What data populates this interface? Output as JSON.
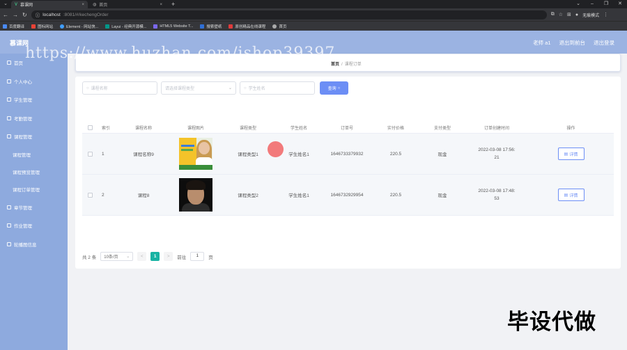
{
  "browser": {
    "tabs": [
      {
        "title": "慕课网"
      },
      {
        "title": "首页"
      }
    ],
    "address": {
      "host": "localhost",
      "path": ":8081/#/kechengOrder"
    },
    "profile": "无痕模式",
    "bookmarks": [
      "百度翻译",
      "图标网站",
      "Element - 网站快...",
      "Layui - 经典开源模...",
      "HTML5 Website T...",
      "搜索壁纸",
      "原创精品在线课程",
      "首页"
    ]
  },
  "header": {
    "brand": "慕课网",
    "user": "老师 a1",
    "exit_backend": "退出到前台",
    "logout": "退出登录"
  },
  "watermark": "https://www.huzhan.com/ishop39397",
  "sidebar": {
    "items": [
      {
        "label": "首页"
      },
      {
        "label": "个人中心"
      },
      {
        "label": "学生管理"
      },
      {
        "label": "考勤管理"
      },
      {
        "label": "课程管理"
      },
      {
        "label": "课程管理"
      },
      {
        "label": "课程预览管理"
      },
      {
        "label": "课程订单管理"
      },
      {
        "label": "章节管理"
      },
      {
        "label": "作业管理"
      },
      {
        "label": "轮播图信息"
      }
    ]
  },
  "breadcrumb": {
    "home": "首页",
    "sep": "/",
    "current": "课程订单"
  },
  "search": {
    "course_name_placeholder": "课程名称",
    "course_type_placeholder": "请选择课程类型",
    "student_name_placeholder": "学生姓名",
    "search_label": "查询"
  },
  "table": {
    "headers": [
      "索引",
      "课程名称",
      "课程图片",
      "课程类型",
      "学生姓名",
      "订单号",
      "实付价格",
      "支付类型",
      "订单创建时间",
      "操作"
    ],
    "rows": [
      {
        "index": "1",
        "course_name": "课程名称9",
        "course_type": "课程类型1",
        "student": "学生姓名1",
        "order_no": "1646733379932",
        "price": "220.5",
        "pay_type": "现金",
        "time_a": "2022-03-08 17:56:",
        "time_b": "21",
        "action": "详情"
      },
      {
        "index": "2",
        "course_name": "课程8",
        "course_type": "课程类型2",
        "student": "学生姓名1",
        "order_no": "1646732929954",
        "price": "220.5",
        "pay_type": "现金",
        "time_a": "2022-03-08 17:48:",
        "time_b": "53",
        "action": "详情"
      }
    ]
  },
  "pager": {
    "total": "共 2 条",
    "page_size": "10条/页",
    "prev": "<",
    "current": "1",
    "next": ">",
    "goto_label": "前往",
    "goto_value": "1",
    "page_unit": "页"
  },
  "overlay": "毕设代做",
  "colors": {
    "header": "#9bb3e2",
    "sidebar": "#8eaade",
    "primary": "#6c8ef5",
    "pager_active": "#17b3a3"
  }
}
